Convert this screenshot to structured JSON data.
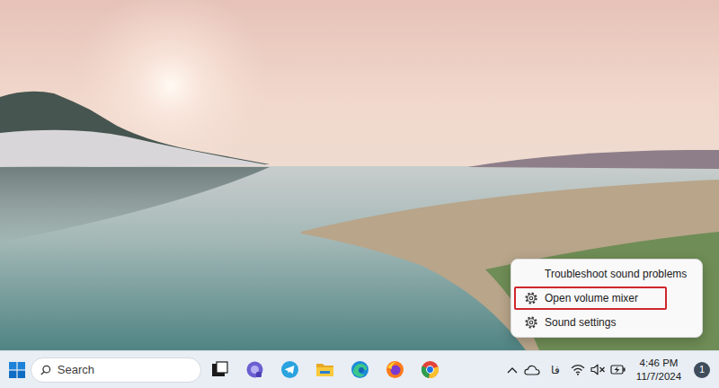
{
  "context_menu": {
    "items": [
      {
        "label": "Troubleshoot sound problems",
        "kind": "plain",
        "highlighted": false
      },
      {
        "label": "Open volume mixer",
        "kind": "settings",
        "highlighted": true
      },
      {
        "label": "Sound settings",
        "kind": "settings",
        "highlighted": false
      }
    ]
  },
  "taskbar": {
    "search": {
      "placeholder": "Search"
    }
  },
  "tray": {
    "language": "فا",
    "volume": {
      "muted": true
    },
    "clock": {
      "time": "4:46 PM",
      "date": "11/7/2024"
    },
    "notifications": "1"
  }
}
